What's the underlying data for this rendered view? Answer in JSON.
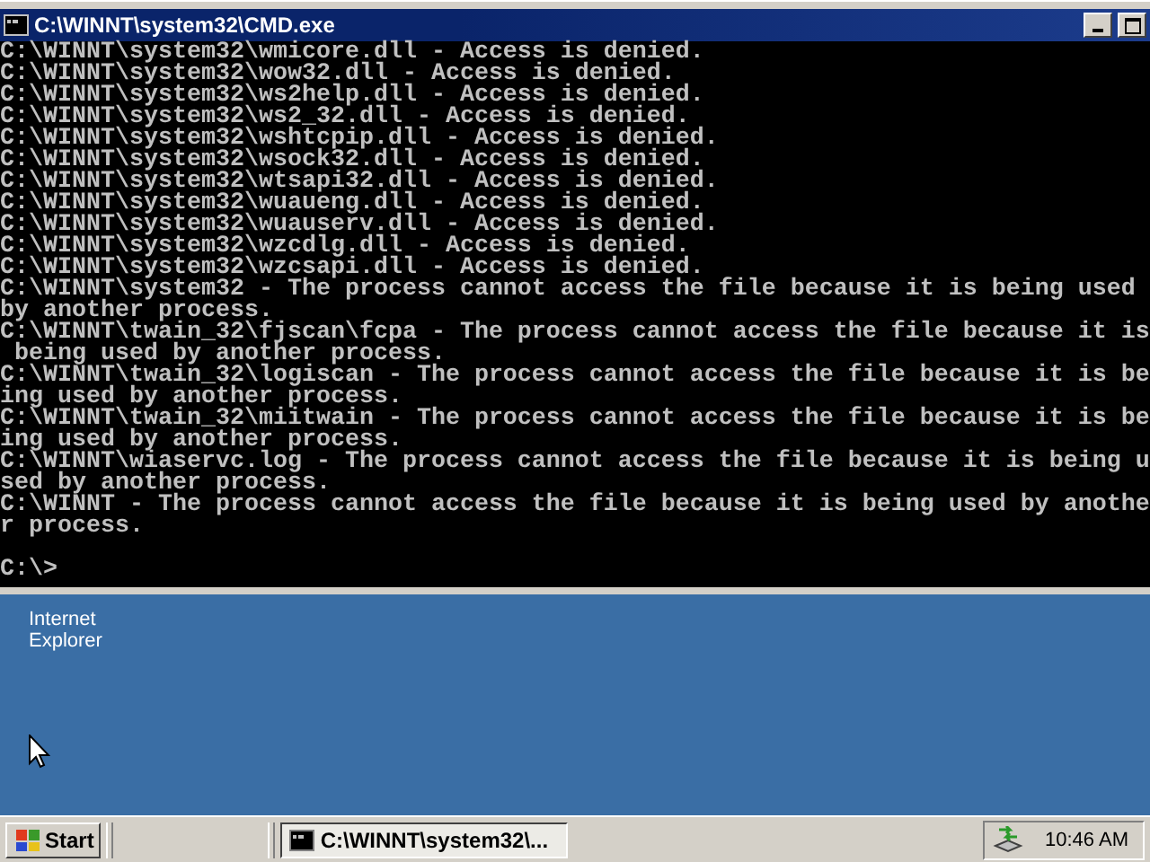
{
  "window": {
    "title": "C:\\WINNT\\system32\\CMD.exe"
  },
  "console": {
    "lines": [
      "C:\\WINNT\\system32\\wmicore.dll - Access is denied.",
      "C:\\WINNT\\system32\\wow32.dll - Access is denied.",
      "C:\\WINNT\\system32\\ws2help.dll - Access is denied.",
      "C:\\WINNT\\system32\\ws2_32.dll - Access is denied.",
      "C:\\WINNT\\system32\\wshtcpip.dll - Access is denied.",
      "C:\\WINNT\\system32\\wsock32.dll - Access is denied.",
      "C:\\WINNT\\system32\\wtsapi32.dll - Access is denied.",
      "C:\\WINNT\\system32\\wuaueng.dll - Access is denied.",
      "C:\\WINNT\\system32\\wuauserv.dll - Access is denied.",
      "C:\\WINNT\\system32\\wzcdlg.dll - Access is denied.",
      "C:\\WINNT\\system32\\wzcsapi.dll - Access is denied.",
      "C:\\WINNT\\system32 - The process cannot access the file because it is being used",
      "by another process.",
      "C:\\WINNT\\twain_32\\fjscan\\fcpa - The process cannot access the file because it is",
      " being used by another process.",
      "C:\\WINNT\\twain_32\\logiscan - The process cannot access the file because it is be",
      "ing used by another process.",
      "C:\\WINNT\\twain_32\\miitwain - The process cannot access the file because it is be",
      "ing used by another process.",
      "C:\\WINNT\\wiaservc.log - The process cannot access the file because it is being u",
      "sed by another process.",
      "C:\\WINNT - The process cannot access the file because it is being used by anothe",
      "r process."
    ],
    "prompt": "C:\\>"
  },
  "desktop": {
    "icons": [
      {
        "label": "Internet Explorer"
      }
    ]
  },
  "taskbar": {
    "start": "Start",
    "tasks": [
      {
        "label": "C:\\WINNT\\system32\\...",
        "selected": true
      }
    ],
    "clock": "10:46 AM"
  }
}
